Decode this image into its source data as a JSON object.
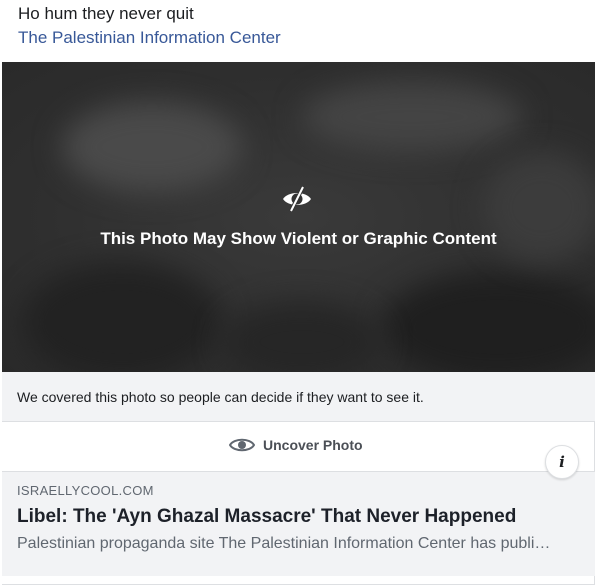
{
  "post": {
    "text": "Ho hum they never quit",
    "link_text": "The Palestinian Information Center"
  },
  "photo_warning": {
    "icon": "eye-slash-icon",
    "title": "This Photo May Show Violent or Graphic Content",
    "notice": "We covered this photo so people can decide if they want to see it.",
    "uncover_icon": "eye-icon",
    "uncover_label": "Uncover Photo"
  },
  "link_preview": {
    "domain": "ISRAELLYCOOL.COM",
    "headline": "Libel: The 'Ayn Ghazal Massacre' That Never Happened",
    "description": "Palestinian propaganda site The Palestinian Information Center has published a piece claiming",
    "info_icon": "info-icon",
    "info_label": "i"
  },
  "colors": {
    "link": "#385898",
    "overlay": "#2f2f2f",
    "panel": "#f2f3f5"
  }
}
